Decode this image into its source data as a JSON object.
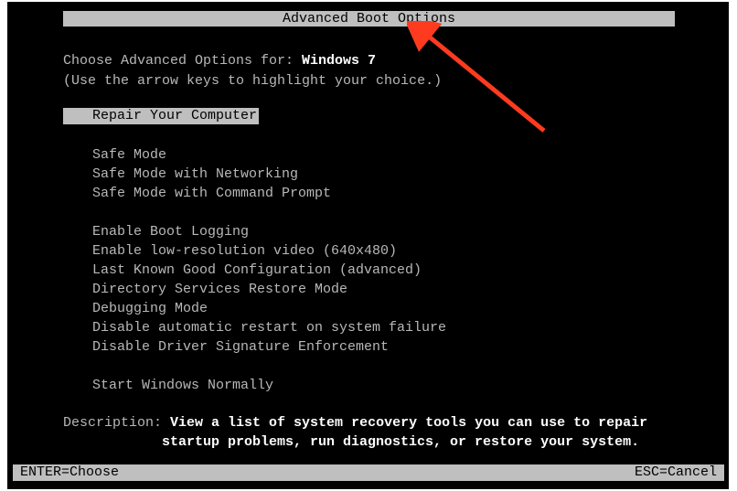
{
  "title": "Advanced Boot Options",
  "intro": {
    "line1_prefix": "Choose Advanced Options for: ",
    "osname": "Windows 7",
    "line2": "(Use the arrow keys to highlight your choice.)"
  },
  "selected": "Repair Your Computer",
  "options": {
    "group1": [
      "Safe Mode",
      "Safe Mode with Networking",
      "Safe Mode with Command Prompt"
    ],
    "group2": [
      "Enable Boot Logging",
      "Enable low-resolution video (640x480)",
      "Last Known Good Configuration (advanced)",
      "Directory Services Restore Mode",
      "Debugging Mode",
      "Disable automatic restart on system failure",
      "Disable Driver Signature Enforcement"
    ],
    "group3": [
      "Start Windows Normally"
    ]
  },
  "description": {
    "label": "Description: ",
    "text_line1": "View a list of system recovery tools you can use to repair",
    "text_line2": "startup problems, run diagnostics, or restore your system."
  },
  "footer": {
    "enter": "ENTER=Choose",
    "esc": "ESC=Cancel"
  },
  "colors": {
    "bg": "#000000",
    "text": "#b8b8b8",
    "highlight_bg": "#bfbfbf",
    "highlight_fg": "#000000",
    "bright": "#ffffff",
    "arrow": "#ff3b1f"
  }
}
